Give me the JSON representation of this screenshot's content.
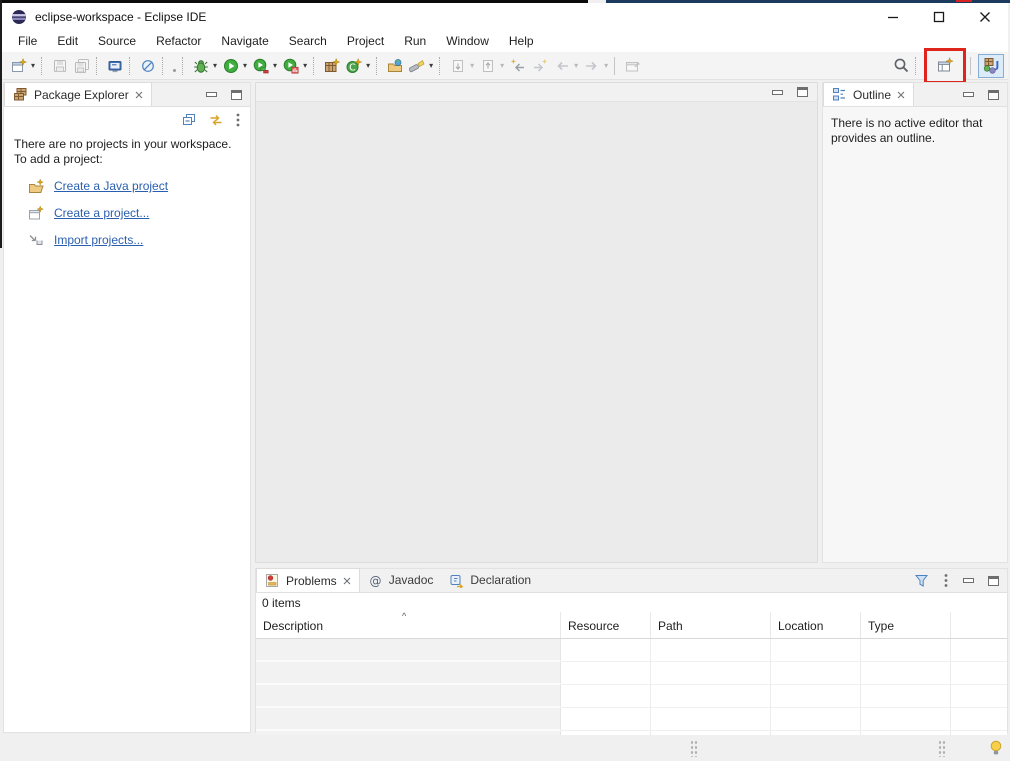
{
  "window": {
    "title": "eclipse-workspace - Eclipse IDE"
  },
  "menu": {
    "items": [
      "File",
      "Edit",
      "Source",
      "Refactor",
      "Navigate",
      "Search",
      "Project",
      "Run",
      "Window",
      "Help"
    ]
  },
  "package_explorer": {
    "tab_label": "Package Explorer",
    "empty_line1": "There are no projects in your workspace.",
    "empty_line2": "To add a project:",
    "links": [
      {
        "label": "Create a Java project"
      },
      {
        "label": "Create a project..."
      },
      {
        "label": "Import projects..."
      }
    ]
  },
  "outline": {
    "tab_label": "Outline",
    "message": "There is no active editor that provides an outline."
  },
  "bottom": {
    "tabs": [
      {
        "label": "Problems",
        "selected": true
      },
      {
        "label": "Javadoc",
        "selected": false
      },
      {
        "label": "Declaration",
        "selected": false
      }
    ],
    "items_count": "0 items",
    "columns": [
      "Description",
      "Resource",
      "Path",
      "Location",
      "Type"
    ],
    "sort_indicator": "^"
  },
  "colors": {
    "highlight_red": "#de241b",
    "link_blue": "#2a5fb0",
    "frame_navy": "#1c3a5e",
    "frame_black": "#0b0b0b",
    "java_perspective_active_bg": "#dcebf9"
  }
}
